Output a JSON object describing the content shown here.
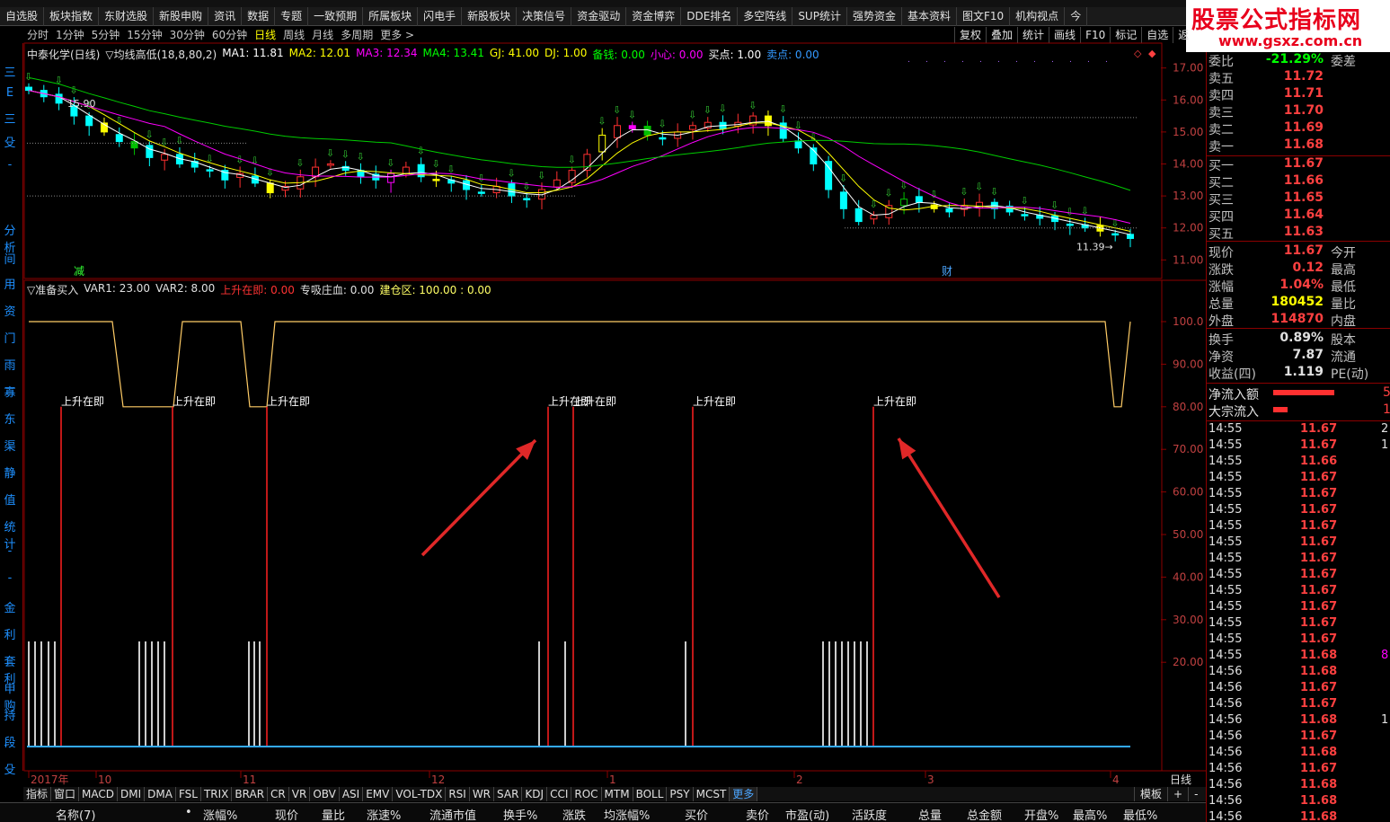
{
  "menu": [
    "自选股",
    "板块指数",
    "东财选股",
    "新股申购",
    "资讯",
    "数据",
    "专题",
    "一致预期",
    "所属板块",
    "闪电手",
    "新股板块",
    "决策信号",
    "资金驱动",
    "资金博弈",
    "DDE排名",
    "多空阵线",
    "SUP统计",
    "强势资金",
    "基本资料",
    "图文F10",
    "机构视点",
    "今"
  ],
  "watermark": {
    "title": "股票公式指标网",
    "url": "www.gsxz.com.cn"
  },
  "periods": [
    {
      "label": "分时",
      "active": false
    },
    {
      "label": "1分钟",
      "active": false
    },
    {
      "label": "5分钟",
      "active": false
    },
    {
      "label": "15分钟",
      "active": false
    },
    {
      "label": "30分钟",
      "active": false
    },
    {
      "label": "60分钟",
      "active": false
    },
    {
      "label": "日线",
      "active": true
    },
    {
      "label": "周线",
      "active": false
    },
    {
      "label": "月线",
      "active": false
    },
    {
      "label": "多周期",
      "active": false
    },
    {
      "label": "更多 >",
      "active": false
    }
  ],
  "right_buttons": [
    "复权",
    "叠加",
    "统计",
    "画线",
    "F10",
    "标记",
    "自选",
    "返"
  ],
  "left_chars": [
    {
      "t": "三",
      "y": 22
    },
    {
      "t": "E",
      "y": 48
    },
    {
      "t": "三",
      "y": 74
    },
    {
      "t": "殳",
      "y": 100
    },
    {
      "t": "-",
      "y": 128
    },
    {
      "t": "分析",
      "y": 198
    },
    {
      "t": "间",
      "y": 230
    },
    {
      "t": "用",
      "y": 258
    },
    {
      "t": "资",
      "y": 288
    },
    {
      "t": "门",
      "y": 318
    },
    {
      "t": "雨",
      "y": 348
    },
    {
      "t": "寡",
      "y": 378
    },
    {
      "t": "东",
      "y": 408
    },
    {
      "t": "渠",
      "y": 438
    },
    {
      "t": "静",
      "y": 468
    },
    {
      "t": "值",
      "y": 498
    },
    {
      "t": "统计",
      "y": 528
    },
    {
      "t": "-",
      "y": 558
    },
    {
      "t": "-",
      "y": 588
    },
    {
      "t": "金",
      "y": 618
    },
    {
      "t": "利",
      "y": 648
    },
    {
      "t": "套利",
      "y": 678
    },
    {
      "t": "申购",
      "y": 708
    },
    {
      "t": "持",
      "y": 738
    },
    {
      "t": "段",
      "y": 768
    },
    {
      "t": "殳",
      "y": 798
    }
  ],
  "main_info": [
    {
      "t": "中泰化学(日线)",
      "c": "#e0e0e0"
    },
    {
      "t": "▽均线高低(18,8,80,2)",
      "c": "#e0e0e0"
    },
    {
      "t": "MA1: 11.81",
      "c": "#ffffff"
    },
    {
      "t": "MA2: 12.01",
      "c": "#ffff00"
    },
    {
      "t": "MA3: 12.34",
      "c": "#ff00ff"
    },
    {
      "t": "MA4: 13.41",
      "c": "#00ff00"
    },
    {
      "t": "GJ: 41.00",
      "c": "#ffff00"
    },
    {
      "t": "DJ: 1.00",
      "c": "#ffff00"
    },
    {
      "t": "备钱: 0.00",
      "c": "#00ff00"
    },
    {
      "t": "小心: 0.00",
      "c": "#ff00ff"
    },
    {
      "t": "买点: 1.00",
      "c": "#ffffff"
    },
    {
      "t": "卖点: 0.00",
      "c": "#3399ff"
    }
  ],
  "sub_info": [
    {
      "t": "▽准备买入",
      "c": "#e0e0e0"
    },
    {
      "t": "VAR1: 23.00",
      "c": "#e0e0e0"
    },
    {
      "t": "VAR2: 8.00",
      "c": "#e0e0e0"
    },
    {
      "t": "上升在即: 0.00",
      "c": "#ff3333"
    },
    {
      "t": "专吸庄血: 0.00",
      "c": "#e0e0e0"
    },
    {
      "t": "建仓区: 100.00 : 0.00",
      "c": "#ffff66"
    }
  ],
  "chart_data": [
    {
      "type": "candlestick",
      "title": "中泰化学(日线)",
      "ylim": [
        10.7,
        17.3
      ],
      "yticks": [
        "17.00",
        "16.00",
        "15.00",
        "14.00",
        "13.00",
        "12.00",
        "11.00"
      ],
      "annotations": [
        "15.90",
        "11.39"
      ],
      "marks": [
        "减",
        "财"
      ],
      "series_closes": [
        16.3,
        16.1,
        15.9,
        15.5,
        15.2,
        15.0,
        14.7,
        14.5,
        14.2,
        14.3,
        14.0,
        13.9,
        13.8,
        13.5,
        13.7,
        13.4,
        13.1,
        13.3,
        13.6,
        13.9,
        14.0,
        13.8,
        13.6,
        13.5,
        13.7,
        13.9,
        13.6,
        13.5,
        13.4,
        13.2,
        13.1,
        13.3,
        13.0,
        12.9,
        13.2,
        13.5,
        13.8,
        14.3,
        14.9,
        15.2,
        15.1,
        14.9,
        14.8,
        15.0,
        15.2,
        15.3,
        15.1,
        15.3,
        15.5,
        15.2,
        14.8,
        14.5,
        14.0,
        13.2,
        12.6,
        12.2,
        12.4,
        12.7,
        12.9,
        12.8,
        12.6,
        12.5,
        12.7,
        12.8,
        12.6,
        12.5,
        12.4,
        12.3,
        12.2,
        12.1,
        12.0,
        11.9,
        11.8,
        11.67
      ]
    },
    {
      "type": "line",
      "title": "准备买入",
      "ylim": [
        0,
        110
      ],
      "yticks": [
        "100.0",
        "90.00",
        "80.00",
        "70.00",
        "60.00",
        "50.00",
        "40.00",
        "30.00",
        "20.00"
      ],
      "series": [
        {
          "name": "建仓区",
          "values": [
            100,
            100,
            100,
            100,
            80,
            80,
            80,
            80,
            100,
            100,
            80,
            100,
            100,
            100,
            100,
            100,
            100,
            100,
            100,
            100,
            100,
            100,
            100,
            100,
            100,
            100,
            100,
            100,
            100,
            100,
            100,
            100,
            100,
            100,
            100,
            100,
            100,
            100,
            100,
            100,
            100,
            100,
            100,
            100,
            100,
            100,
            100,
            100,
            100,
            100,
            100,
            100,
            100,
            100,
            100,
            100,
            100,
            100,
            100,
            80,
            100
          ]
        }
      ],
      "signal_labels": [
        "上升在即",
        "上升在即",
        "上升在即",
        "上升在即",
        "上升在即",
        "上升在即",
        "上升在即"
      ]
    }
  ],
  "xaxis_labels": [
    "2017年",
    "10",
    "11",
    "12",
    "1",
    "2",
    "3",
    "4"
  ],
  "period_label": "日线",
  "quote": {
    "weibi": {
      "label": "委比",
      "value": "-21.29%",
      "extra": "委差"
    },
    "asks": [
      [
        "卖五",
        "11.72"
      ],
      [
        "卖四",
        "11.71"
      ],
      [
        "卖三",
        "11.70"
      ],
      [
        "卖二",
        "11.69"
      ],
      [
        "卖一",
        "11.68"
      ]
    ],
    "bids": [
      [
        "买一",
        "11.67"
      ],
      [
        "买二",
        "11.66"
      ],
      [
        "买三",
        "11.65"
      ],
      [
        "买四",
        "11.64"
      ],
      [
        "买五",
        "11.63"
      ]
    ],
    "stats": [
      [
        "现价",
        "11.67",
        "今开",
        "#ff4040"
      ],
      [
        "涨跌",
        "0.12",
        "最高",
        "#ff4040"
      ],
      [
        "涨幅",
        "1.04%",
        "最低",
        "#ff4040"
      ],
      [
        "总量",
        "180452",
        "量比",
        "#ffff00"
      ],
      [
        "外盘",
        "114870",
        "内盘",
        "#ff4040"
      ]
    ],
    "stats2": [
      [
        "换手",
        "0.89%",
        "股本"
      ],
      [
        "净资",
        "7.87",
        "流通"
      ],
      [
        "收益(四)",
        "1.119",
        "PE(动)"
      ]
    ],
    "flows": [
      [
        "净流入额",
        "5"
      ],
      [
        "大宗流入",
        "1"
      ]
    ]
  },
  "ticks": [
    [
      "14:55",
      "11.67",
      "2"
    ],
    [
      "14:55",
      "11.67",
      "1"
    ],
    [
      "14:55",
      "11.66",
      ""
    ],
    [
      "14:55",
      "11.67",
      ""
    ],
    [
      "14:55",
      "11.67",
      ""
    ],
    [
      "14:55",
      "11.67",
      ""
    ],
    [
      "14:55",
      "11.67",
      ""
    ],
    [
      "14:55",
      "11.67",
      ""
    ],
    [
      "14:55",
      "11.67",
      ""
    ],
    [
      "14:55",
      "11.67",
      ""
    ],
    [
      "14:55",
      "11.67",
      ""
    ],
    [
      "14:55",
      "11.67",
      ""
    ],
    [
      "14:55",
      "11.67",
      ""
    ],
    [
      "14:55",
      "11.67",
      ""
    ],
    [
      "14:55",
      "11.68",
      "8"
    ],
    [
      "14:56",
      "11.68",
      ""
    ],
    [
      "14:56",
      "11.67",
      ""
    ],
    [
      "14:56",
      "11.67",
      ""
    ],
    [
      "14:56",
      "11.68",
      "1"
    ],
    [
      "14:56",
      "11.67",
      ""
    ],
    [
      "14:56",
      "11.68",
      ""
    ],
    [
      "14:56",
      "11.67",
      ""
    ],
    [
      "14:56",
      "11.68",
      ""
    ],
    [
      "14:56",
      "11.68",
      ""
    ],
    [
      "14:56",
      "11.68",
      ""
    ]
  ],
  "bottom_tabs": [
    "指标",
    "窗口",
    "MACD",
    "DMI",
    "DMA",
    "FSL",
    "TRIX",
    "BRAR",
    "CR",
    "VR",
    "OBV",
    "ASI",
    "EMV",
    "VOL-TDX",
    "RSI",
    "WR",
    "SAR",
    "KDJ",
    "CCI",
    "ROC",
    "MTM",
    "BOLL",
    "PSY",
    "MCST",
    "更多"
  ],
  "bottom_right": [
    "模板",
    "+",
    "-"
  ],
  "columns": [
    "名称(7)",
    "•",
    "涨幅%",
    "现价",
    "量比",
    "涨速%",
    "流通市值",
    "换手%",
    "涨跌",
    "均涨幅%",
    "买价",
    "卖价",
    "市盈(动)",
    "活跃度",
    "总量",
    "总金额",
    "开盘%",
    "最高%",
    "最低%"
  ]
}
